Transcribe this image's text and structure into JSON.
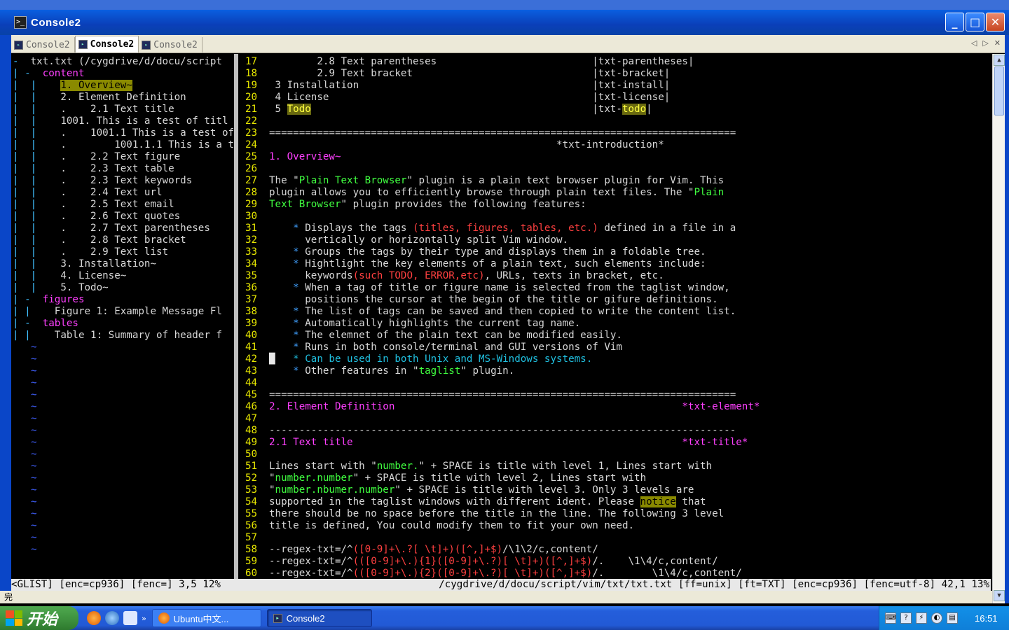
{
  "background_strip": "",
  "window": {
    "title": "Console2"
  },
  "tabs": [
    {
      "label": "Console2",
      "active": false
    },
    {
      "label": "Console2",
      "active": true
    },
    {
      "label": "Console2",
      "active": false
    }
  ],
  "taglist": {
    "lines": [
      [
        [
          "fold",
          "-"
        ],
        [
          "",
          "  txt.txt (/cygdrive/d/docu/script"
        ]
      ],
      [
        [
          "fold",
          "| -"
        ],
        [
          "c-mag",
          "  content"
        ]
      ],
      [
        [
          "fold",
          "|  |"
        ],
        [
          "",
          "    "
        ],
        [
          "hl-y",
          "1. Overview~"
        ]
      ],
      [
        [
          "fold",
          "|  |"
        ],
        [
          "",
          "    2. Element Definition"
        ]
      ],
      [
        [
          "fold",
          "|  |"
        ],
        [
          "",
          "    .    2.1 Text title"
        ]
      ],
      [
        [
          "fold",
          "|  |"
        ],
        [
          "",
          "    1001. This is a test of titl"
        ]
      ],
      [
        [
          "fold",
          "|  |"
        ],
        [
          "",
          "    .    1001.1 This is a test of"
        ]
      ],
      [
        [
          "fold",
          "|  |"
        ],
        [
          "",
          "    .        1001.1.1 This is a t"
        ]
      ],
      [
        [
          "fold",
          "|  |"
        ],
        [
          "",
          "    .    2.2 Text figure"
        ]
      ],
      [
        [
          "fold",
          "|  |"
        ],
        [
          "",
          "    .    2.3 Text table"
        ]
      ],
      [
        [
          "fold",
          "|  |"
        ],
        [
          "",
          "    .    2.3 Text keywords"
        ]
      ],
      [
        [
          "fold",
          "|  |"
        ],
        [
          "",
          "    .    2.4 Text url"
        ]
      ],
      [
        [
          "fold",
          "|  |"
        ],
        [
          "",
          "    .    2.5 Text email"
        ]
      ],
      [
        [
          "fold",
          "|  |"
        ],
        [
          "",
          "    .    2.6 Text quotes"
        ]
      ],
      [
        [
          "fold",
          "|  |"
        ],
        [
          "",
          "    .    2.7 Text parentheses"
        ]
      ],
      [
        [
          "fold",
          "|  |"
        ],
        [
          "",
          "    .    2.8 Text bracket"
        ]
      ],
      [
        [
          "fold",
          "|  |"
        ],
        [
          "",
          "    .    2.9 Text list"
        ]
      ],
      [
        [
          "fold",
          "|  |"
        ],
        [
          "",
          "    3. Installation~"
        ]
      ],
      [
        [
          "fold",
          "|  |"
        ],
        [
          "",
          "    4. License~"
        ]
      ],
      [
        [
          "fold",
          "|  |"
        ],
        [
          "",
          "    5. Todo~"
        ]
      ],
      [
        [
          "fold",
          "| -"
        ],
        [
          "c-mag",
          "  figures"
        ]
      ],
      [
        [
          "fold",
          "| |"
        ],
        [
          "",
          "    Figure 1: Example Message Fl"
        ]
      ],
      [
        [
          "fold",
          "| -"
        ],
        [
          "c-mag",
          "  tables"
        ]
      ],
      [
        [
          "fold",
          "| |"
        ],
        [
          "",
          "    Table 1: Summary of header f"
        ]
      ]
    ],
    "tilde_count": 18
  },
  "editor": {
    "lines": [
      [
        17,
        [
          [
            "",
            "        2.8 Text parentheses                          |txt-parentheses|"
          ]
        ]
      ],
      [
        18,
        [
          [
            "",
            "        2.9 Text bracket                              |txt-bracket|"
          ]
        ]
      ],
      [
        19,
        [
          [
            "",
            " 3 Installation                                       |txt-install|"
          ]
        ]
      ],
      [
        20,
        [
          [
            "",
            " 4 License                                            |txt-license|"
          ]
        ]
      ],
      [
        21,
        [
          [
            "",
            " 5 "
          ],
          [
            "hl-y2",
            "Todo"
          ],
          [
            "",
            "                                               |txt-"
          ],
          [
            "hl-y2",
            "todo"
          ],
          [
            "",
            "|"
          ]
        ]
      ],
      [
        22,
        []
      ],
      [
        23,
        [
          [
            "",
            "=============================================================================="
          ]
        ]
      ],
      [
        24,
        [
          [
            "",
            "                                                *txt-introduction*"
          ]
        ]
      ],
      [
        25,
        [
          [
            "c-mag",
            "1. Overview~"
          ]
        ]
      ],
      [
        26,
        []
      ],
      [
        27,
        [
          [
            "",
            "The \""
          ],
          [
            "c-grn",
            "Plain Text Browser"
          ],
          [
            "",
            "\" plugin is a plain text browser plugin for Vim. This"
          ]
        ]
      ],
      [
        28,
        [
          [
            "",
            "plugin allows you to efficiently browse through plain text files. The \""
          ],
          [
            "c-grn",
            "Plain"
          ]
        ]
      ],
      [
        29,
        [
          [
            "c-grn",
            "Text Browser"
          ],
          [
            "",
            "\" plugin provides the following features:"
          ]
        ]
      ],
      [
        30,
        []
      ],
      [
        31,
        [
          [
            "",
            "    "
          ],
          [
            "c-blu",
            "*"
          ],
          [
            "",
            " Displays the tags "
          ],
          [
            "c-red",
            "(titles, figures, tables, etc.)"
          ],
          [
            "",
            " defined in a file in a"
          ]
        ]
      ],
      [
        32,
        [
          [
            "",
            "      vertically or horizontally split Vim window."
          ]
        ]
      ],
      [
        33,
        [
          [
            "",
            "    "
          ],
          [
            "c-blu",
            "*"
          ],
          [
            "",
            " Groups the tags by their type and displays them in a foldable tree."
          ]
        ]
      ],
      [
        34,
        [
          [
            "",
            "    "
          ],
          [
            "c-blu",
            "*"
          ],
          [
            "",
            " Hightlight the key elements of a plain text, such elements include:"
          ]
        ]
      ],
      [
        35,
        [
          [
            "",
            "      keywords"
          ],
          [
            "c-red",
            "(such TODO, ERROR,etc)"
          ],
          [
            "",
            ", URLs, texts in bracket, etc."
          ]
        ]
      ],
      [
        36,
        [
          [
            "",
            "    "
          ],
          [
            "c-blu",
            "*"
          ],
          [
            "",
            " When a tag of title or figure name is selected from the taglist window,"
          ]
        ]
      ],
      [
        37,
        [
          [
            "",
            "      positions the cursor at the begin of the title or gifure definitions."
          ]
        ]
      ],
      [
        38,
        [
          [
            "",
            "    "
          ],
          [
            "c-blu",
            "*"
          ],
          [
            "",
            " The list of tags can be saved and then copied to write the content list."
          ]
        ]
      ],
      [
        39,
        [
          [
            "",
            "    "
          ],
          [
            "c-blu",
            "*"
          ],
          [
            "",
            " Automatically highlights the current tag name."
          ]
        ]
      ],
      [
        40,
        [
          [
            "",
            "    "
          ],
          [
            "c-blu",
            "*"
          ],
          [
            "",
            " The elemnet of the plain text can be modified easily."
          ]
        ]
      ],
      [
        41,
        [
          [
            "",
            "    "
          ],
          [
            "c-blu",
            "*"
          ],
          [
            "",
            " Runs in both console/terminal and GUI versions of Vim"
          ]
        ]
      ],
      [
        42,
        [
          [
            "cursor",
            "█"
          ],
          [
            "",
            "   "
          ],
          [
            "c-cyan",
            "* Can be used in both Unix and MS-Windows systems."
          ]
        ]
      ],
      [
        43,
        [
          [
            "",
            "    "
          ],
          [
            "c-blu",
            "*"
          ],
          [
            "",
            " Other features in \""
          ],
          [
            "c-grn",
            "taglist"
          ],
          [
            "",
            "\" plugin."
          ]
        ]
      ],
      [
        44,
        []
      ],
      [
        45,
        [
          [
            "",
            "=============================================================================="
          ]
        ]
      ],
      [
        46,
        [
          [
            "c-mag",
            "2. Element Definition                                                *txt-element*"
          ]
        ]
      ],
      [
        47,
        []
      ],
      [
        48,
        [
          [
            "",
            "------------------------------------------------------------------------------"
          ]
        ]
      ],
      [
        49,
        [
          [
            "c-mag",
            "2.1 Text title                                                       *txt-title*"
          ]
        ]
      ],
      [
        50,
        []
      ],
      [
        51,
        [
          [
            "",
            "Lines start with \""
          ],
          [
            "c-grn",
            "number."
          ],
          [
            "",
            "\" + SPACE is title with level 1, Lines start with"
          ]
        ]
      ],
      [
        52,
        [
          [
            "",
            "\""
          ],
          [
            "c-grn",
            "number.number"
          ],
          [
            "",
            "\" + SPACE is title with level 2, Lines start with"
          ]
        ]
      ],
      [
        53,
        [
          [
            "",
            "\""
          ],
          [
            "c-grn",
            "number.nbumer.number"
          ],
          [
            "",
            "\" + SPACE is title with level 3. Only 3 levels are"
          ]
        ]
      ],
      [
        54,
        [
          [
            "",
            "supported in the taglist windows with different ident. Please "
          ],
          [
            "hl-y",
            "notice"
          ],
          [
            "",
            " that"
          ]
        ]
      ],
      [
        55,
        [
          [
            "",
            "there should be no space before the title in the line. The following 3 level"
          ]
        ]
      ],
      [
        56,
        [
          [
            "",
            "title is defined, You could modify them to fit your own need."
          ]
        ]
      ],
      [
        57,
        []
      ],
      [
        58,
        [
          [
            "",
            "--regex-txt=/^"
          ],
          [
            "c-red",
            "([0-9]+\\.?[ \\t]+)([^,]+$)"
          ],
          [
            "",
            "/\\1\\2/c,content/"
          ]
        ]
      ],
      [
        59,
        [
          [
            "",
            "--regex-txt=/^"
          ],
          [
            "c-red",
            "(([0-9]+\\.){1}([0-9]+\\.?)[ \\t]+)([^,]+$)"
          ],
          [
            "",
            "/.    \\1\\4/c,content/"
          ]
        ]
      ],
      [
        60,
        [
          [
            "",
            "--regex-txt=/^"
          ],
          [
            "c-red",
            "(([0-9]+\\.){2}([0-9]+\\.?)[ \\t]+)([^,]+$)"
          ],
          [
            "",
            "/.        \\1\\4/c,content/"
          ]
        ]
      ]
    ]
  },
  "status": {
    "left": "<GLIST] [enc=cp936] [fenc=] 3,5 12%",
    "right": "/cygdrive/d/docu/script/vim/txt/txt.txt [ff=unix] [ft=TXT] [enc=cp936] [fenc=utf-8] 42,1 13%"
  },
  "bottom_strip": "完",
  "taskbar": {
    "start_label": "开始",
    "tasks": [
      {
        "label": "Ubuntu中文..."
      },
      {
        "label": "Console2"
      }
    ],
    "clock": "16:51"
  },
  "colors": {
    "titlebar": "#0a46c8",
    "line_number": "#e6e600",
    "heading": "#ff40ff",
    "quoted": "#40ff40",
    "keyword": "#ff4040"
  }
}
